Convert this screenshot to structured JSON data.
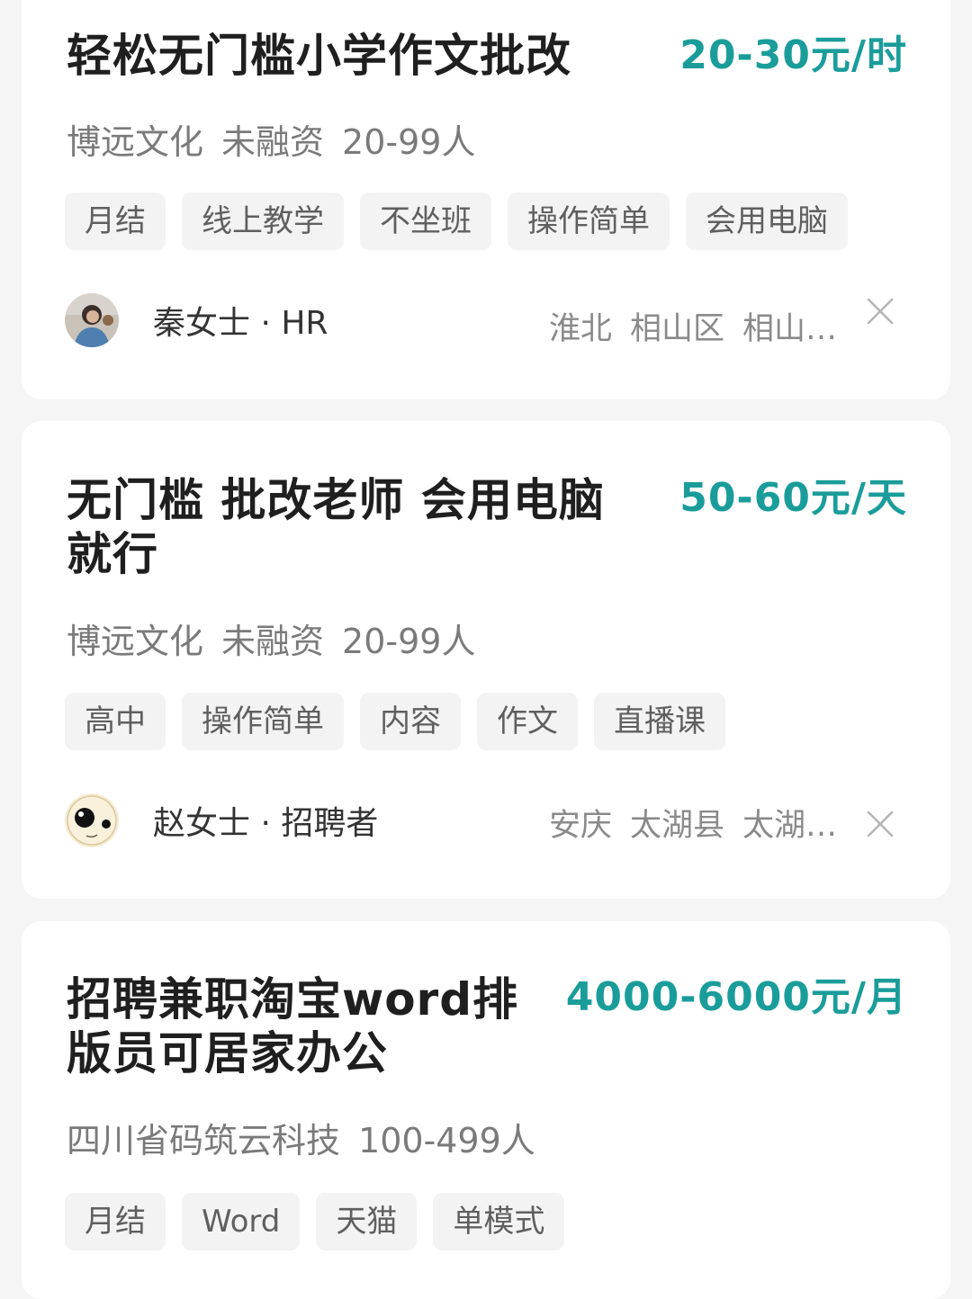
{
  "jobs": [
    {
      "title": "轻松无门槛小学作文批改",
      "salary": "20-30元/时",
      "company": {
        "name": "博远文化",
        "funding": "未融资",
        "size": "20-99人"
      },
      "tags": [
        "月结",
        "线上教学",
        "不坐班",
        "操作简单",
        "会用电脑"
      ],
      "recruiter": "秦女士 · HR",
      "location": {
        "city": "淮北",
        "district": "相山区",
        "area": "相山…"
      },
      "avatar_icon": "person-photo-icon"
    },
    {
      "title": "无门槛 批改老师 会用电脑就行",
      "salary": "50-60元/天",
      "company": {
        "name": "博远文化",
        "funding": "未融资",
        "size": "20-99人"
      },
      "tags": [
        "高中",
        "操作简单",
        "内容",
        "作文",
        "直播课"
      ],
      "recruiter": "赵女士 · 招聘者",
      "location": {
        "city": "安庆",
        "district": "太湖县",
        "area": "太湖…"
      },
      "avatar_icon": "cartoon-face-icon"
    },
    {
      "title": "招聘兼职淘宝word排版员可居家办公",
      "salary": "4000-6000元/月",
      "company": {
        "name": "四川省码筑云科技",
        "size": "100-499人"
      },
      "tags": [
        "月结",
        "Word",
        "天猫",
        "单模式"
      ]
    }
  ],
  "colors": {
    "salary": "#1a9d9a",
    "background": "#f5f5f5",
    "card": "#ffffff",
    "tag_bg": "#f3f3f3"
  }
}
